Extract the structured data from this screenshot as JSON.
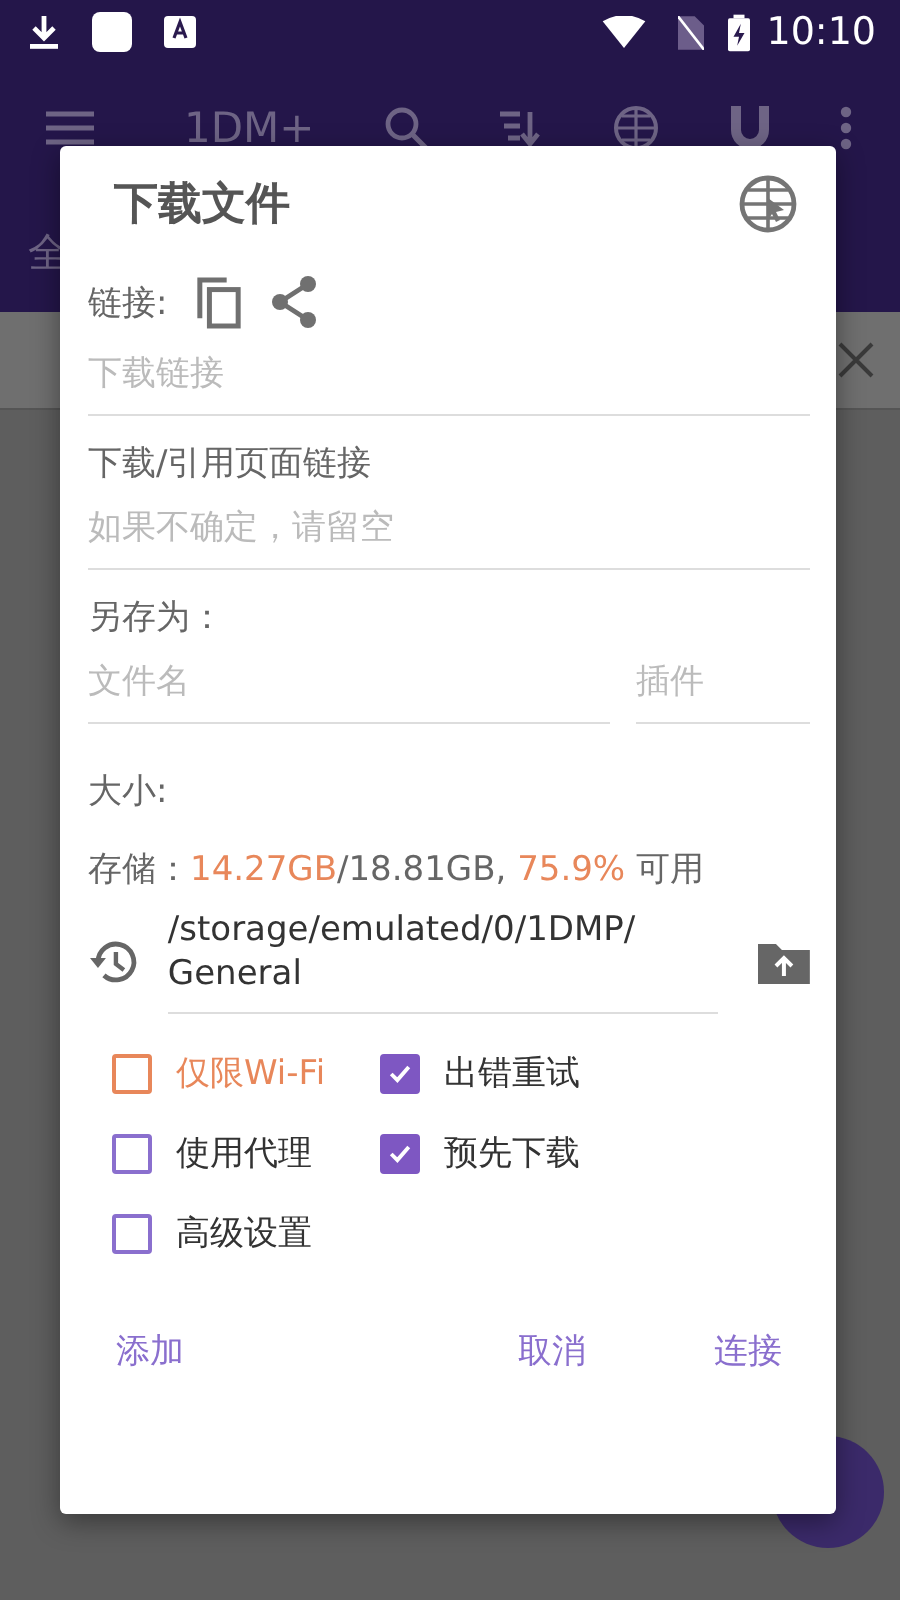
{
  "status_bar": {
    "time": "10:10"
  },
  "toolbar": {
    "title": "1DM+"
  },
  "tab_row": {
    "label": "全"
  },
  "dialog": {
    "title": "下载文件",
    "link_label": "链接:",
    "link_field": {
      "placeholder": "下载链接"
    },
    "referer_label": "下载/引用页面链接",
    "referer_field": {
      "placeholder": "如果不确定，请留空"
    },
    "save_as_label": "另存为：",
    "filename_field": {
      "placeholder": "文件名"
    },
    "plugin_field": {
      "placeholder": "插件"
    },
    "size_label": "大小:",
    "storage": {
      "label": "存储：",
      "free": "14.27GB",
      "total": "/18.81GB,",
      "percent": "75.9%",
      "suffix": "可用"
    },
    "path": "/storage/emulated/0/1DMP/ General",
    "options": [
      {
        "label": "仅限Wi-Fi",
        "checked": false,
        "warning": true
      },
      {
        "label": "出错重试",
        "checked": true,
        "warning": false
      },
      {
        "label": "使用代理",
        "checked": false,
        "warning": false
      },
      {
        "label": "预先下载",
        "checked": true,
        "warning": false
      },
      {
        "label": "高级设置",
        "checked": false,
        "warning": false
      }
    ],
    "buttons": [
      {
        "label": "添加"
      },
      {
        "label": "取消"
      },
      {
        "label": "连接"
      }
    ]
  }
}
